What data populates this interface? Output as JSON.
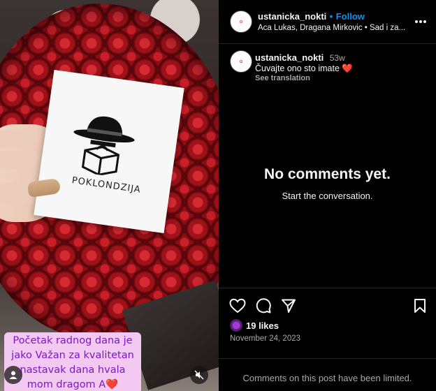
{
  "header": {
    "username": "ustanicka_nokti",
    "separator": "•",
    "follow_label": "Follow",
    "subtitle": "Aca Lukas, Dragana Mirkovic • Sad i za..."
  },
  "comment": {
    "username": "ustanicka_nokti",
    "age": "53w",
    "text": "Čuvajte ono sto imate ❤️",
    "translation_label": "See translation"
  },
  "empty_state": {
    "title": "No comments yet.",
    "subtitle": "Start the conversation."
  },
  "stats": {
    "likes": "19 likes",
    "date": "November 24, 2023"
  },
  "footer": {
    "limited_text": "Comments on this post have been limited."
  },
  "media": {
    "card_brand": "POKLONDZIJA",
    "caption_lines": [
      "Početak radnog dana je",
      "jako Važan za kvalitetan",
      "nastavak dana hvala",
      "mom dragom A❤️"
    ]
  },
  "colors": {
    "follow": "#0095f6",
    "caption_bg": "#f3c8f1",
    "caption_text": "#7b17c9",
    "background": "#000000"
  },
  "icons": [
    "more-icon",
    "heart-icon",
    "comment-icon",
    "share-icon",
    "bookmark-icon",
    "mute-icon",
    "user-tag-icon"
  ]
}
